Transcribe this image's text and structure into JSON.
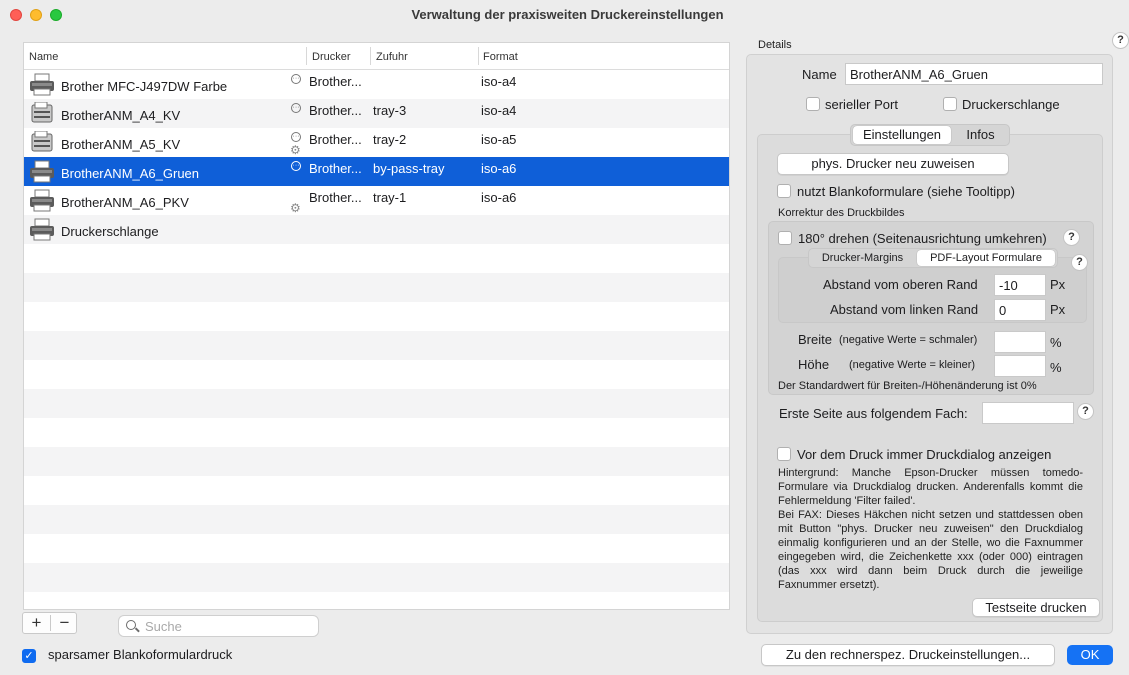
{
  "window": {
    "title": "Verwaltung der praxisweiten Druckereinstellungen"
  },
  "table": {
    "columns": {
      "name": "Name",
      "drucker": "Drucker",
      "zufuhr": "Zufuhr",
      "format": "Format"
    },
    "rows": [
      {
        "name": "Brother MFC-J497DW Farbe",
        "drucker": "Brother...",
        "zufuhr": "",
        "format": "iso-a4"
      },
      {
        "name": "BrotherANM_A4_KV",
        "drucker": "Brother...",
        "zufuhr": "tray-3",
        "format": "iso-a4"
      },
      {
        "name": "BrotherANM_A5_KV",
        "drucker": "Brother...",
        "zufuhr": "tray-2",
        "format": "iso-a5"
      },
      {
        "name": "BrotherANM_A6_Gruen",
        "drucker": "Brother...",
        "zufuhr": "by-pass-tray",
        "format": "iso-a6"
      },
      {
        "name": "BrotherANM_A6_PKV",
        "drucker": "Brother...",
        "zufuhr": "tray-1",
        "format": "iso-a6"
      },
      {
        "name": "Druckerschlange",
        "drucker": "",
        "zufuhr": "",
        "format": ""
      }
    ]
  },
  "bottom": {
    "add_label": "+",
    "remove_label": "−",
    "search_placeholder": "Suche",
    "sparsam_label": "sparsamer Blankoformulardruck",
    "rechnerspez_label": "Zu den rechnerspez. Druckeinstellungen...",
    "ok_label": "OK"
  },
  "details": {
    "label": "Details",
    "help": "?",
    "name_label": "Name",
    "name_value": "BrotherANM_A6_Gruen",
    "serieller_port": "serieller Port",
    "druckerschlange": "Druckerschlange",
    "tabs": {
      "einstellungen": "Einstellungen",
      "infos": "Infos"
    },
    "phys_button": "phys. Drucker neu zuweisen",
    "blanko_label": "nutzt Blankoformulare (siehe Tooltipp)",
    "korrektur_label": "Korrektur des Druckbildes",
    "drehen_label": "180° drehen (Seitenausrichtung umkehren)",
    "subtabs": {
      "margins": "Drucker-Margins",
      "pdf": "PDF-Layout Formulare"
    },
    "oben_label": "Abstand vom oberen Rand",
    "oben_value": "-10",
    "links_label": "Abstand vom linken Rand",
    "links_value": "0",
    "px": "Px",
    "breite_label": "Breite",
    "breite_hint": "(negative Werte = schmaler)",
    "hoehe_label": "Höhe",
    "hoehe_hint": "(negative Werte = kleiner)",
    "percent": "%",
    "standard_note": "Der Standardwert für Breiten-/Höhenänderung ist 0%",
    "fach_label": "Erste Seite aus folgendem Fach:",
    "druckdialog_label": "Vor dem Druck immer Druckdialog anzeigen",
    "hintergrund_text": "Hintergrund: Manche Epson-Drucker müssen tomedo-Formulare via Druckdialog drucken. Anderenfalls kommt die Fehlermeldung 'Filter failed'.",
    "fax_text": "Bei FAX: Dieses Häkchen nicht setzen und stattdessen oben mit Button \"phys. Drucker neu zuweisen\" den Druckdialog einmalig konfigurieren und an der Stelle, wo die Faxnummer eingegeben wird, die Zeichenkette xxx (oder 000) eintragen (das xxx wird dann beim Druck durch die jeweilige Faxnummer ersetzt).",
    "testseite_button": "Testseite drucken"
  }
}
